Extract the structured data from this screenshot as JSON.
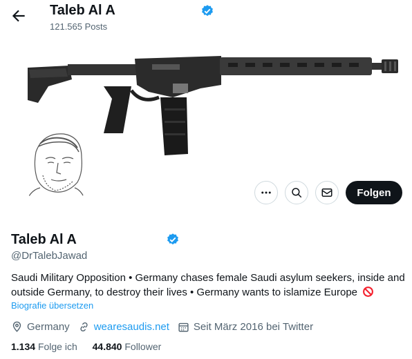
{
  "header": {
    "title": "Taleb Al A",
    "posts": "121.565 Posts"
  },
  "profile": {
    "name": "Taleb Al A",
    "handle": "@DrTalebJawad",
    "bio": "Saudi Military Opposition • Germany chases female Saudi asylum seekers, inside and outside Germany, to destroy their lives • Germany wants to islamize Europe",
    "translate_label": "Biografie übersetzen",
    "location": "Germany",
    "website": "wearesaudis.net",
    "joined": "Seit März 2016 bei Twitter",
    "following_count": "1.134",
    "following_label": "Folge ich",
    "followers_count": "44.840",
    "followers_label": "Follower"
  },
  "actions": {
    "follow_label": "Folgen"
  },
  "icons": [
    "back-arrow-icon",
    "verified-badge-icon",
    "more-icon",
    "search-icon",
    "mail-icon",
    "location-icon",
    "link-icon",
    "calendar-icon",
    "no-entry-icon"
  ],
  "colors": {
    "accent": "#1d9bf0",
    "text": "#0f1419",
    "muted": "#536471",
    "follow_button": "#0f1419",
    "no_entry": "#f4212e"
  }
}
